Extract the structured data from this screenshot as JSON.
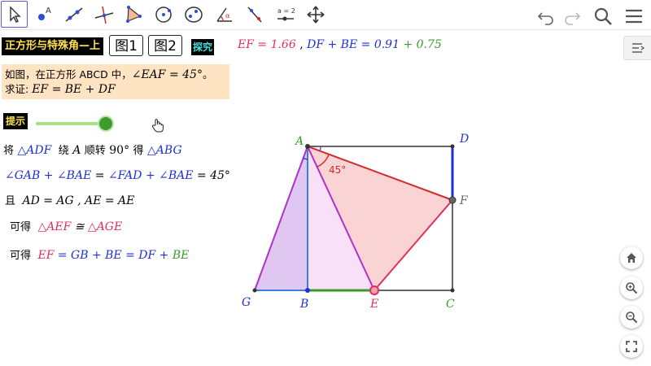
{
  "toolbar": {
    "tools": [
      {
        "name": "move-tool",
        "selected": true
      },
      {
        "name": "point-tool"
      },
      {
        "name": "line-tool"
      },
      {
        "name": "perpendicular-tool"
      },
      {
        "name": "polygon-tool"
      },
      {
        "name": "circle-tool"
      },
      {
        "name": "conic-tool"
      },
      {
        "name": "angle-tool"
      },
      {
        "name": "reflect-tool"
      },
      {
        "name": "slider-tool"
      },
      {
        "name": "move-graphics-tool"
      }
    ],
    "slider_tool_label": "a = 2",
    "right_icons": [
      "undo-icon",
      "redo-icon",
      "search-icon",
      "menu-icon"
    ]
  },
  "panel": {
    "title": "正方形与特殊角—上",
    "fig_buttons": [
      "图1",
      "图2"
    ],
    "explore": "探究",
    "eq_ef": "EF = 1.66",
    "eq_sep": ",",
    "eq_df": "DF + BE",
    "eq_equals": "=",
    "eq_df_val": "0.91",
    "eq_plus": "+",
    "eq_be_val": "0.75",
    "problem_line1_a": "如图，在正方形 ABCD 中，",
    "problem_line1_b": "∠EAF = 45°",
    "problem_line1_c": "。",
    "problem_line2_a": "求证:",
    "problem_line2_b": "EF = BE + DF",
    "hint": "提示",
    "slider_value": 1.0,
    "step1": {
      "a": "将",
      "b": "△ADF",
      "c": "绕",
      "d": "A",
      "e": "顺转",
      "f": "90°",
      "g": "得",
      "h": "△ABG"
    },
    "step2": {
      "a": "∠GAB + ∠BAE",
      "b": "=",
      "c": "∠FAD + ∠BAE",
      "d": "= 45°"
    },
    "step3": {
      "a": "且",
      "b": "AD = AG , AE = AE"
    },
    "step4": {
      "a": "可得",
      "b": "△AEF",
      "c": "≅",
      "d": "△AGE"
    },
    "step5": {
      "a": "可得",
      "b": "EF",
      "c": "= GB + BE = DF +",
      "d": "BE"
    }
  },
  "graphics": {
    "labels": {
      "A": "A",
      "B": "B",
      "C": "C",
      "D": "D",
      "E": "E",
      "F": "F",
      "G": "G"
    },
    "angle_label": "45°"
  },
  "side_buttons": [
    "home-icon",
    "zoom-in-icon",
    "zoom-out-icon",
    "fullscreen-icon"
  ],
  "colors": {
    "accent": "#6557d2",
    "blue": "#1f2fd6",
    "red": "#e0305a",
    "green": "#3a9a2a",
    "purple": "#b030c8",
    "highlight": "#ffe4c4"
  }
}
